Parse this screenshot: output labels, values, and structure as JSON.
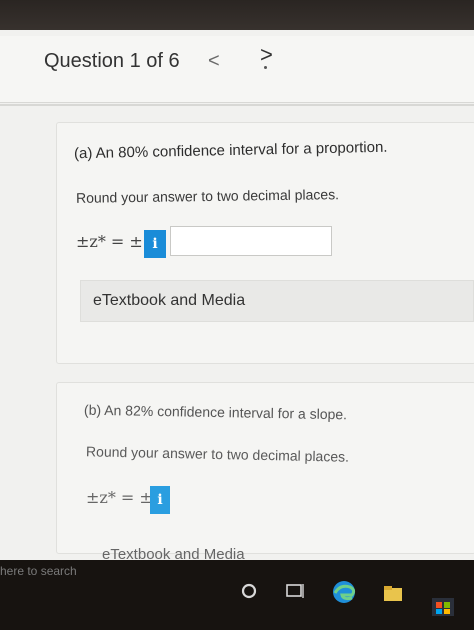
{
  "header": {
    "question_counter": "Question 1 of 6",
    "prev_glyph": "<",
    "next_glyph": ">"
  },
  "part_a": {
    "prompt": "(a) An 80% confidence interval for a proportion.",
    "instruction": "Round your answer to two decimal places.",
    "formula": "±z* = ±",
    "info_glyph": "i",
    "answer_value": "",
    "etextbook_label": "eTextbook and Media"
  },
  "part_b": {
    "prompt": "(b) An 82% confidence interval for a slope.",
    "instruction": "Round your answer to two decimal places.",
    "formula": "±z* = ±",
    "info_glyph": "i",
    "etextbook_label": "eTextbook and Media"
  },
  "taskbar": {
    "search_placeholder": "here to search"
  },
  "colors": {
    "info_button": "#1a8cd8",
    "panel_background": "#f5f5f3",
    "page_background": "#f1f1ef"
  }
}
